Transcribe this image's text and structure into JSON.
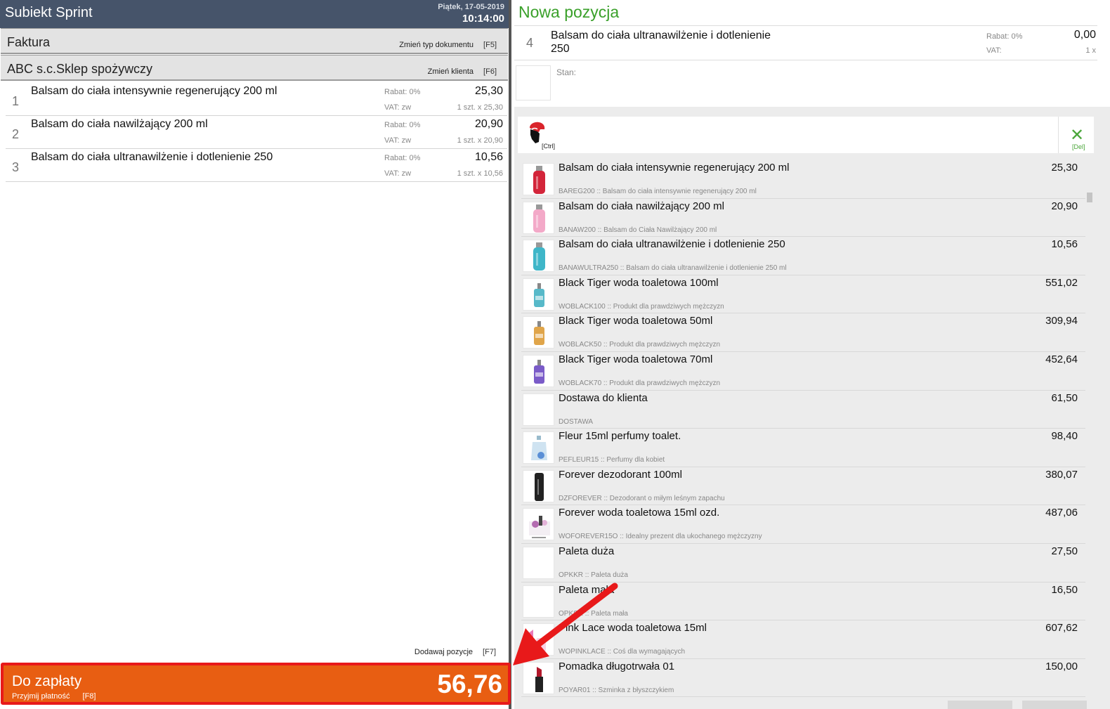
{
  "app": {
    "title": "Subiekt Sprint",
    "date": "Piątek, 17-05-2019",
    "time": "10:14:00"
  },
  "document": {
    "type": "Faktura",
    "change_type_label": "Zmień typ dokumentu",
    "change_type_key": "[F5]"
  },
  "client": {
    "name": "ABC s.c.Sklep spożywczy",
    "change_label": "Zmień klienta",
    "change_key": "[F6]"
  },
  "lines": [
    {
      "no": "1",
      "name": "Balsam do ciała intensywnie regenerujący 200 ml",
      "rabat": "Rabat:  0%",
      "vat": "VAT:  zw",
      "price": "25,30",
      "qty": "1 szt. x 25,30"
    },
    {
      "no": "2",
      "name": "Balsam do ciała nawilżający 200 ml",
      "rabat": "Rabat:  0%",
      "vat": "VAT:  zw",
      "price": "20,90",
      "qty": "1 szt. x 20,90"
    },
    {
      "no": "3",
      "name": "Balsam do ciała ultranawilżenie i dotlenienie 250",
      "rabat": "Rabat:  0%",
      "vat": "VAT:  zw",
      "price": "10,56",
      "qty": "1 szt. x 10,56"
    }
  ],
  "add_positions": {
    "label": "Dodawaj pozycje",
    "key": "[F7]"
  },
  "payment": {
    "label": "Do zapłaty",
    "sub_label": "Przyjmij płatność",
    "sub_key": "[F8]",
    "total": "56,76"
  },
  "new_position": {
    "title": "Nowa pozycja",
    "no": "4",
    "name": "Balsam do ciała ultranawilżenie i dotlenienie 250",
    "rabat": "Rabat:   0%",
    "vat": "VAT:",
    "price": "0,00",
    "qty": "1  x",
    "stan_label": "Stan:"
  },
  "search": {
    "ctrl_label": "[Ctrl]",
    "del_label": "[Del]"
  },
  "products": [
    {
      "name": "Balsam do ciała intensywnie regenerujący 200 ml",
      "desc": "BAREG200 :: Balsam do ciała intensywnie regenerujący 200 ml",
      "price": "25,30",
      "thumb": "red-bottle",
      "color": "#d3253a"
    },
    {
      "name": "Balsam do ciała nawilżający 200 ml",
      "desc": "BANAW200 :: Balsam do Ciała Nawilżający 200 ml",
      "price": "20,90",
      "thumb": "pink-bottle",
      "color": "#f3a9c8"
    },
    {
      "name": "Balsam do ciała ultranawilżenie i dotlenienie 250",
      "desc": "BANAWULTRA250 :: Balsam do ciała ultranawilżenie i dotlenienie 250 ml",
      "price": "10,56",
      "thumb": "teal-bottle",
      "color": "#3fb6c8"
    },
    {
      "name": "Black Tiger woda toaletowa 100ml",
      "desc": "WOBLACK100 :: Produkt dla prawdziwych mężczyzn",
      "price": "551,02",
      "thumb": "perfume-blue",
      "color": "#57b9c9"
    },
    {
      "name": "Black Tiger woda toaletowa 50ml",
      "desc": "WOBLACK50 :: Produkt dla prawdziwych mężczyzn",
      "price": "309,94",
      "thumb": "perfume-amber",
      "color": "#e0a54a"
    },
    {
      "name": "Black Tiger woda toaletowa 70ml",
      "desc": "WOBLACK70 :: Produkt dla prawdziwych mężczyzn",
      "price": "452,64",
      "thumb": "perfume-violet",
      "color": "#7a5bc8"
    },
    {
      "name": "Dostawa do klienta",
      "desc": "DOSTAWA",
      "price": "61,50",
      "thumb": "",
      "color": ""
    },
    {
      "name": "Fleur 15ml perfumy toalet.",
      "desc": "PEFLEUR15 :: Perfumy dla kobiet",
      "price": "98,40",
      "thumb": "perfume-fleur",
      "color": "#5a8fd6"
    },
    {
      "name": "Forever dezodorant 100ml",
      "desc": "DZFOREVER :: Dezodorant o miłym leśnym zapachu",
      "price": "380,07",
      "thumb": "black-can",
      "color": "#222222"
    },
    {
      "name": "Forever woda toaletowa 15ml ozd.",
      "desc": "WOFOREVER15O :: Idealny prezent dla ukochanego mężczyzny",
      "price": "487,06",
      "thumb": "gift-set",
      "color": "#b36bb0"
    },
    {
      "name": "Paleta duża",
      "desc": "OPKKR :: Paleta duża",
      "price": "27,50",
      "thumb": "",
      "color": ""
    },
    {
      "name": "Paleta mała",
      "desc": "OPKSR :: Paleta mała",
      "price": "16,50",
      "thumb": "",
      "color": ""
    },
    {
      "name": "Pink Lace woda toaletowa 15ml",
      "desc": "WOPINKLACE :: Coś dla wymagających",
      "price": "607,62",
      "thumb": "pink-perfume",
      "color": "#e879b8"
    },
    {
      "name": "Pomadka długotrwała 01",
      "desc": "POYAR01 :: Szminka z błyszczykiem",
      "price": "150,00",
      "thumb": "lipstick",
      "color": "#b2182b"
    }
  ]
}
